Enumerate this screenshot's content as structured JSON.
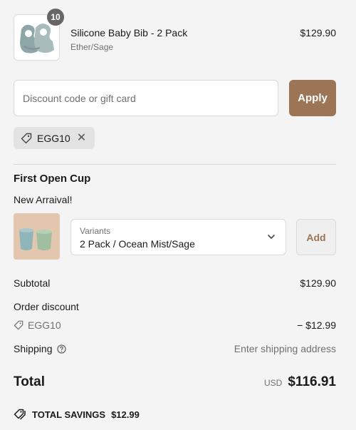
{
  "line_item": {
    "quantity": "10",
    "name": "Silicone Baby Bib - 2 Pack",
    "variant": "Ether/Sage",
    "price": "$129.90"
  },
  "discount": {
    "placeholder": "Discount code or gift card",
    "apply_label": "Apply",
    "applied_code": "EGG10"
  },
  "upsell": {
    "title": "First Open Cup",
    "subtitle": "New Arraival!",
    "variant_label": "Variants",
    "variant_value": "2 Pack / Ocean Mist/Sage",
    "add_label": "Add"
  },
  "summary": {
    "subtotal_label": "Subtotal",
    "subtotal_value": "$129.90",
    "order_discount_label": "Order discount",
    "discount_code": "EGG10",
    "discount_value": "− $12.99",
    "shipping_label": "Shipping",
    "shipping_value": "Enter shipping address",
    "total_label": "Total",
    "currency": "USD",
    "total_value": "$116.91",
    "savings_label": "TOTAL SAVINGS",
    "savings_value": "$12.99"
  },
  "colors": {
    "accent": "#9b7556",
    "background": "#f4f4f4"
  }
}
